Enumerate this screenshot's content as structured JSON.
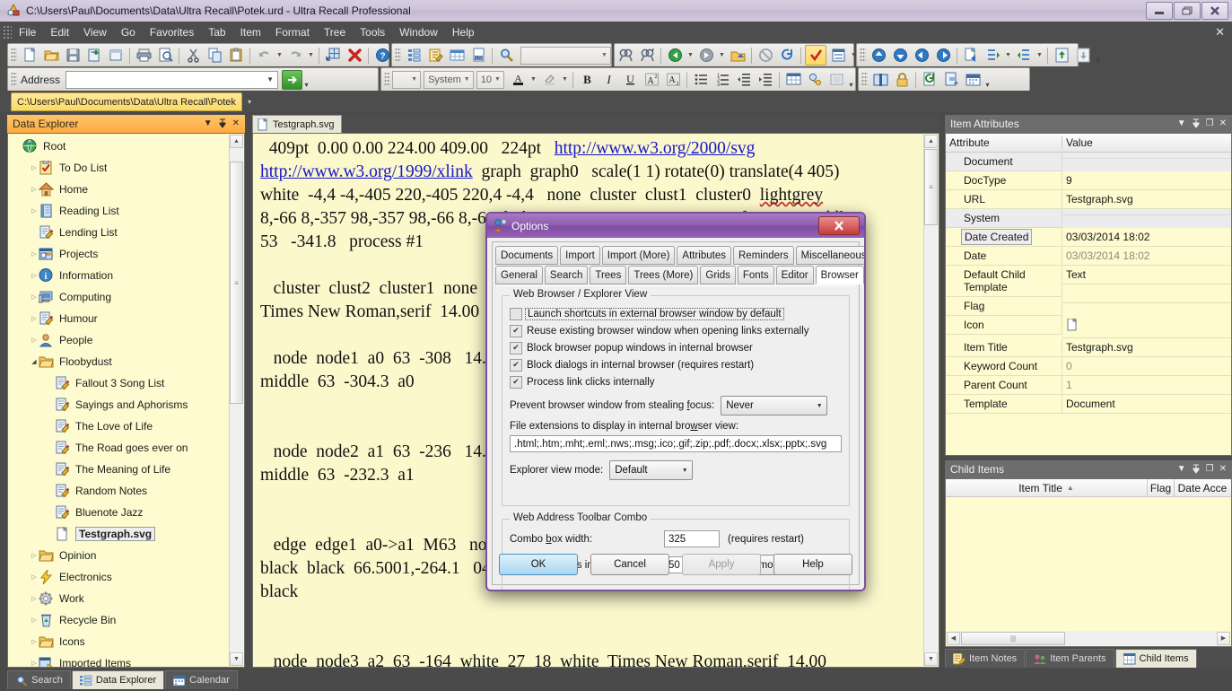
{
  "window": {
    "title": "C:\\Users\\Paul\\Documents\\Data\\Ultra Recall\\Potek.urd - Ultra Recall Professional",
    "minimize": "—",
    "maximize": "❐",
    "close": "✕"
  },
  "menu": {
    "items": [
      "File",
      "Edit",
      "View",
      "Go",
      "Favorites",
      "Tab",
      "Item",
      "Format",
      "Tree",
      "Tools",
      "Window",
      "Help"
    ],
    "close_label": "✕"
  },
  "toolbar": {
    "address_label": "Address",
    "address_value": "",
    "address_placeholder": "",
    "go_label": "➜",
    "search_value": "",
    "style_value": "",
    "font_value": "System",
    "size_value": "10"
  },
  "filetab": {
    "label": "C:\\Users\\Paul\\Documents\\Data\\Ultra Recall\\Potek"
  },
  "data_explorer": {
    "title": "Data Explorer",
    "buttons": [
      "▾",
      "📌",
      "✕"
    ],
    "items": [
      {
        "label": "Root",
        "icon": "globe-icon",
        "indent": 0,
        "expander": "",
        "selected": false
      },
      {
        "label": "To Do List",
        "icon": "clipboard-check-icon",
        "indent": 1,
        "expander": "▸",
        "selected": false
      },
      {
        "label": "Home",
        "icon": "house-icon",
        "indent": 1,
        "expander": "▸",
        "selected": false
      },
      {
        "label": "Reading List",
        "icon": "book-icon",
        "indent": 1,
        "expander": "▸",
        "selected": false
      },
      {
        "label": "Lending List",
        "icon": "note-pencil-icon",
        "indent": 1,
        "expander": "",
        "selected": false
      },
      {
        "label": "Projects",
        "icon": "projects-icon",
        "indent": 1,
        "expander": "▸",
        "selected": false
      },
      {
        "label": "Information",
        "icon": "info-icon",
        "indent": 1,
        "expander": "▸",
        "selected": false
      },
      {
        "label": "Computing",
        "icon": "monitor-icon",
        "indent": 1,
        "expander": "▸",
        "selected": false
      },
      {
        "label": "Humour",
        "icon": "note-pencil-icon",
        "indent": 1,
        "expander": "▸",
        "selected": false
      },
      {
        "label": "People",
        "icon": "person-icon",
        "indent": 1,
        "expander": "▸",
        "selected": false
      },
      {
        "label": "Floobydust",
        "icon": "folder-icon",
        "indent": 1,
        "expander": "▴",
        "selected": false
      },
      {
        "label": "Fallout 3 Song List",
        "icon": "note-pencil-icon",
        "indent": 2,
        "expander": "",
        "selected": false
      },
      {
        "label": "Sayings and Aphorisms",
        "icon": "note-pencil-icon",
        "indent": 2,
        "expander": "",
        "selected": false
      },
      {
        "label": "The Love of Life",
        "icon": "note-pencil-icon",
        "indent": 2,
        "expander": "",
        "selected": false
      },
      {
        "label": "The Road goes ever on",
        "icon": "note-pencil-icon",
        "indent": 2,
        "expander": "",
        "selected": false
      },
      {
        "label": "The Meaning of Life",
        "icon": "note-pencil-icon",
        "indent": 2,
        "expander": "",
        "selected": false
      },
      {
        "label": "Random Notes",
        "icon": "note-pencil-icon",
        "indent": 2,
        "expander": "",
        "selected": false
      },
      {
        "label": "Bluenote Jazz",
        "icon": "note-pencil-icon",
        "indent": 2,
        "expander": "",
        "selected": false
      },
      {
        "label": "Testgraph.svg",
        "icon": "document-icon",
        "indent": 2,
        "expander": "",
        "selected": true
      },
      {
        "label": "Opinion",
        "icon": "folder-icon",
        "indent": 1,
        "expander": "▸",
        "selected": false
      },
      {
        "label": "Electronics",
        "icon": "bolt-icon",
        "indent": 1,
        "expander": "▸",
        "selected": false
      },
      {
        "label": "Work",
        "icon": "gear-icon",
        "indent": 1,
        "expander": "▸",
        "selected": false
      },
      {
        "label": "Recycle Bin",
        "icon": "recycle-bin-icon",
        "indent": 1,
        "expander": "▸",
        "selected": false
      },
      {
        "label": "Icons",
        "icon": "folder-icon",
        "indent": 1,
        "expander": "▸",
        "selected": false
      },
      {
        "label": "Imported Items",
        "icon": "imported-icon",
        "indent": 1,
        "expander": "▸",
        "selected": false
      }
    ]
  },
  "bottom_tabs": [
    {
      "label": "Search",
      "icon": "magnifier-icon",
      "active": false
    },
    {
      "label": "Data Explorer",
      "icon": "tree-icon",
      "active": true
    },
    {
      "label": "Calendar",
      "icon": "calendar-icon",
      "active": false
    }
  ],
  "document": {
    "tab_label": "Testgraph.svg",
    "lines": [
      "  409pt  0.00 0.00 224.00 409.00   224pt   @http://www.w3.org/2000/svg@",
      "@http://www.w3.org/1999/xlink@  graph  graph0   scale(1 1) rotate(0) translate(4 405)",
      "white  -4,4 -4,-405 220,-405 220,4 -4,4   none  cluster  clust1  cluster0  ~lightgrey~",
      "8,-66 8,-357 98,-357 98,-66 8,-66  lightgrey  Times New Roman,serif  14.00  middle",
      "53   -341.8   process #1",
      "",
      "   cluster  clust2  cluster1  none   blue",
      "Times New Roman,serif  14.00",
      "",
      "   node  node1  a0  63  -308   14.00",
      "middle  63  -304.3  a0",
      "",
      "",
      "   node  node2  a1  63  -236   14.00",
      "middle  63  -232.3  a1",
      "",
      "",
      "   edge  edge1  a0->a1  M63   none",
      "black  black  66.5001,-264.1   04",
      "black",
      "",
      "",
      "   node  node3  a2  63  -164  white  27  18  white  Times New Roman,serif  14.00",
      "middle  63  -160.3  a2"
    ]
  },
  "item_attributes": {
    "title": "Item Attributes",
    "buttons": [
      "▾",
      "📌",
      "❐",
      "✕"
    ],
    "columns": [
      "Attribute",
      "Value"
    ],
    "rows": [
      {
        "type": "group",
        "key": "Document",
        "value": ""
      },
      {
        "type": "value",
        "key": "DocType",
        "value": "9",
        "dim": false
      },
      {
        "type": "value",
        "key": "URL",
        "value": "Testgraph.svg",
        "dim": false
      },
      {
        "type": "group",
        "key": "System",
        "value": ""
      },
      {
        "type": "value",
        "key": "Date Created",
        "value": "03/03/2014 18:02",
        "dim": false,
        "key_focus": true
      },
      {
        "type": "value",
        "key": "Date",
        "value": "03/03/2014 18:02",
        "dim": true
      },
      {
        "type": "value",
        "key": "Default Child Template",
        "value": "Text",
        "dim": false
      },
      {
        "type": "value",
        "key": "Flag",
        "value": "",
        "dim": false
      },
      {
        "type": "value",
        "key": "Icon",
        "value": "",
        "dim": false,
        "icon": "document-icon"
      },
      {
        "type": "value",
        "key": "Item Title",
        "value": "Testgraph.svg",
        "dim": false
      },
      {
        "type": "value",
        "key": "Keyword Count",
        "value": "0",
        "dim": true
      },
      {
        "type": "value",
        "key": "Parent Count",
        "value": "1",
        "dim": true
      },
      {
        "type": "value",
        "key": "Template",
        "value": "Document",
        "dim": false
      }
    ]
  },
  "child_items": {
    "title": "Child Items",
    "buttons": [
      "▾",
      "📌",
      "❐",
      "✕"
    ],
    "columns": [
      "Item Title",
      "Flag",
      "Date Acce"
    ],
    "sort_indicator": "▲",
    "rows": [],
    "tabs": [
      {
        "label": "Item Notes",
        "icon": "note-pencil-icon",
        "active": false
      },
      {
        "label": "Item Parents",
        "icon": "people-icon",
        "active": false
      },
      {
        "label": "Child Items",
        "icon": "grid-icon",
        "active": true
      }
    ]
  },
  "options_dialog": {
    "title": "Options",
    "close_label": "✕",
    "tabs_row1": [
      "Documents",
      "Import",
      "Import (More)",
      "Attributes",
      "Reminders",
      "Miscellaneous"
    ],
    "tabs_row2": [
      "General",
      "Search",
      "Trees",
      "Trees (More)",
      "Grids",
      "Fonts",
      "Editor",
      "Browser"
    ],
    "active_tab": "Browser",
    "group_browser": {
      "title": "Web Browser / Explorer View",
      "checkboxes": [
        {
          "label": "Launch shortcuts in external browser window by default",
          "checked": false,
          "focused": true,
          "accel": "L"
        },
        {
          "label": "Reuse existing browser window when opening links externally",
          "checked": true,
          "focused": false,
          "accel": "u"
        },
        {
          "label": "Block browser popup windows in internal browser",
          "checked": true,
          "focused": false,
          "accel": "p"
        },
        {
          "label": "Block dialogs in internal browser (requires restart)",
          "checked": true,
          "focused": false,
          "accel": "d"
        },
        {
          "label": "Process link clicks internally",
          "checked": true,
          "focused": false,
          "accel": "i"
        }
      ],
      "focus_label": "Prevent browser window from stealing focus:",
      "focus_value": "Never",
      "extensions_label": "File extensions to display in internal browser view:",
      "extensions_value": ".html;.htm;.mht;.eml;.nws;.msg;.ico;.gif;.zip;.pdf;.docx;.xlsx;.pptx;.svg",
      "viewmode_label": "Explorer view mode:",
      "viewmode_value": "Default"
    },
    "group_combo": {
      "title": "Web Address Toolbar Combo",
      "width_label": "Combo box width:",
      "width_value": "325",
      "width_note": "(requires restart)",
      "maxitems_label": "Maximum items in drop-down list:",
      "maxitems_value": "50",
      "remove_all_label": "Remove All"
    },
    "buttons": [
      {
        "label": "OK",
        "style": "primary"
      },
      {
        "label": "Cancel",
        "style": "normal"
      },
      {
        "label": "Apply",
        "style": "disabled"
      },
      {
        "label": "Help",
        "style": "normal"
      }
    ]
  },
  "colors": {
    "accent_orange": "#ffab3e",
    "paper_yellow": "#fdfbcf",
    "dialog_purple": "#8e5cb0",
    "link_blue": "#1515cc"
  }
}
